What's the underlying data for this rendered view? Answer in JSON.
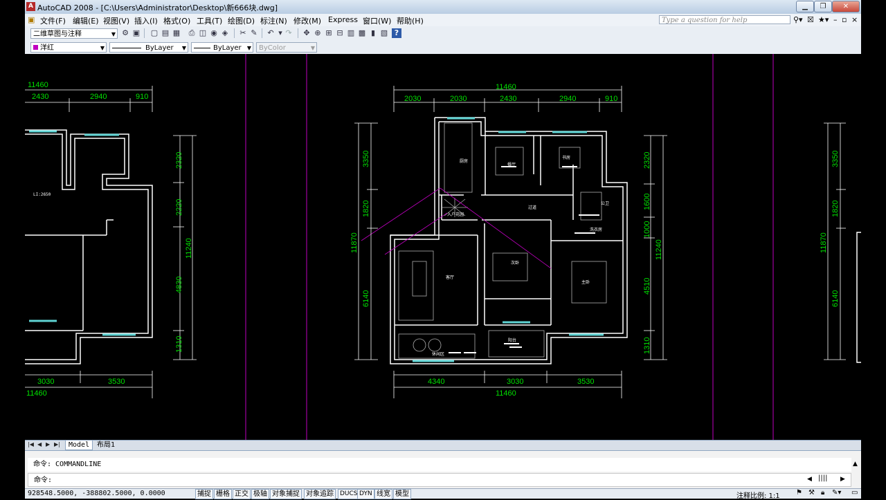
{
  "window": {
    "title": "AutoCAD 2008 - [C:\\Users\\Administrator\\Desktop\\新666块.dwg]",
    "minimize_label": "▁",
    "maximize_label": "❐",
    "close_label": "✕"
  },
  "menu": {
    "items": [
      "文件(F)",
      "编辑(E)",
      "视图(V)",
      "插入(I)",
      "格式(O)",
      "工具(T)",
      "绘图(D)",
      "标注(N)",
      "修改(M)",
      "Express",
      "窗口(W)",
      "帮助(H)"
    ],
    "help_placeholder": "Type a question for help"
  },
  "toolbar": {
    "workspace": "二维草图与注释",
    "layer_color_name": "洋红",
    "linetype": "ByLayer",
    "lineweight": "ByLayer",
    "plotstyle": "ByColor"
  },
  "drawing": {
    "center_total_top": "11460",
    "center_top_dims": [
      "2030",
      "2030",
      "2430",
      "2940",
      "910"
    ],
    "center_left_dims": [
      "3350",
      "1820",
      "6140"
    ],
    "center_left_total": "11870",
    "center_right_dims": [
      "2320",
      "1600",
      "1000",
      "4510",
      "1310"
    ],
    "center_right_total": "11240",
    "center_bottom_dims": [
      "4340",
      "3030",
      "3530"
    ],
    "center_total_bottom": "11460",
    "left_total_top": "11460",
    "left_top_dims": [
      "2430",
      "2940",
      "910"
    ],
    "left_right_dims": [
      "2320",
      "2220",
      "4830",
      "1310"
    ],
    "left_right_total": "11240",
    "left_bottom_dims": [
      "3030",
      "3530"
    ],
    "left_total_bottom": "11460",
    "left_small_label": "LI:2650",
    "right_dims": [
      "3350",
      "1820",
      "6140"
    ],
    "right_total": "11870",
    "rooms": [
      "厨房",
      "餐厅",
      "书房",
      "过道",
      "入户花园",
      "公卫",
      "客厅",
      "次卧",
      "主卧",
      "阳台",
      "休闲区",
      "洗衣房"
    ]
  },
  "tabs": {
    "model": "Model",
    "layout1": "布局1"
  },
  "command": {
    "history": "命令: COMMANDLINE",
    "prompt": "命令:"
  },
  "status": {
    "coords": "928548.5000, -388802.5000, 0.0000",
    "buttons": [
      "捕捉",
      "栅格",
      "正交",
      "极轴",
      "对象捕捉",
      "对象追踪",
      "DUCS",
      "DYN",
      "线宽",
      "模型"
    ],
    "scale_label": "注释比例: 1:1"
  }
}
